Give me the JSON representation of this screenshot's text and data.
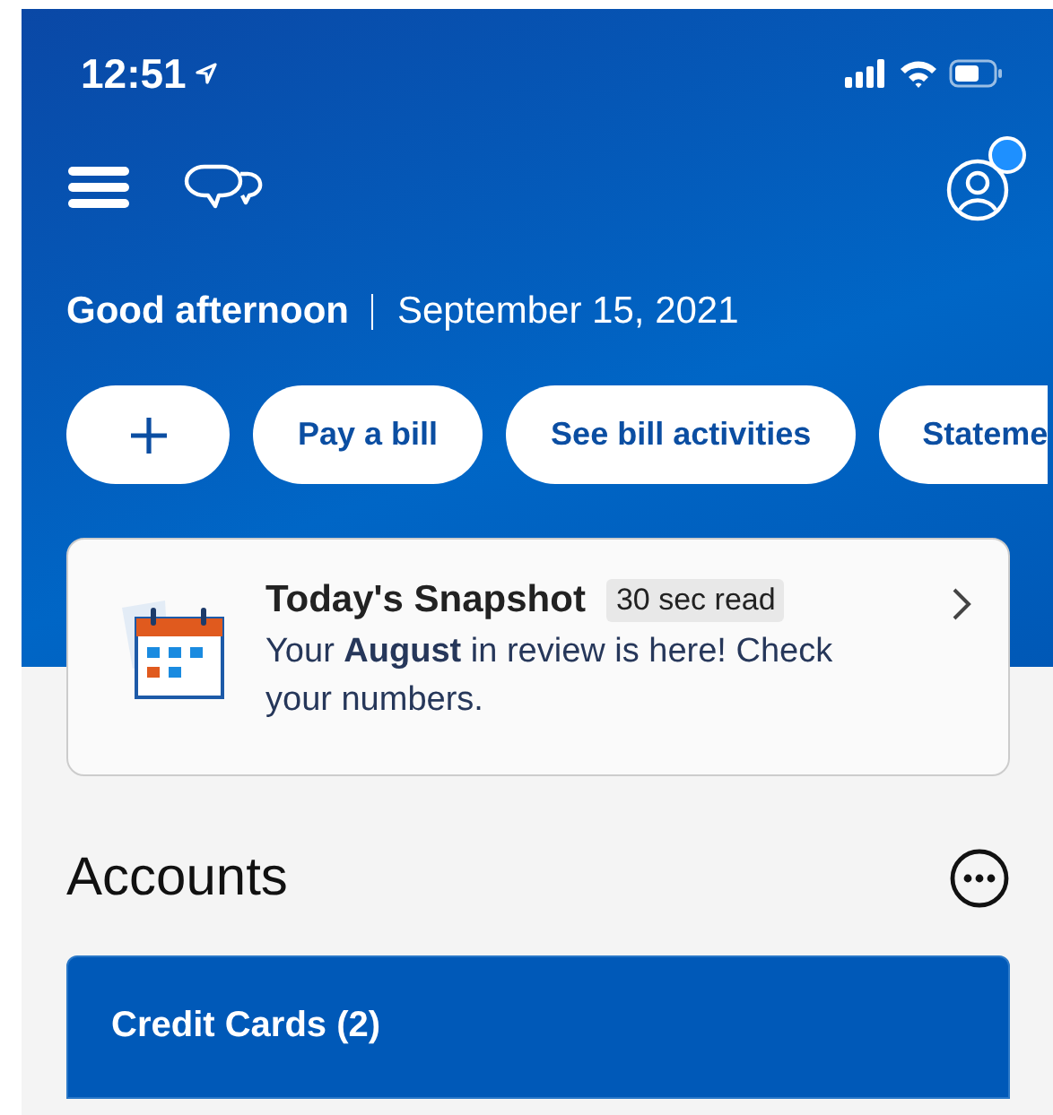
{
  "status_bar": {
    "time": "12:51"
  },
  "nav": {
    "profile_notification": true
  },
  "greeting": {
    "salutation": "Good afternoon",
    "date": "September 15, 2021"
  },
  "quick_actions": [
    {
      "kind": "add"
    },
    {
      "kind": "text",
      "label": "Pay a bill"
    },
    {
      "kind": "text",
      "label": "See bill activities"
    },
    {
      "kind": "text",
      "label": "Stateme"
    }
  ],
  "snapshot": {
    "title": "Today's Snapshot",
    "badge": "30 sec read",
    "message": "Your **August** in review is here! Check your numbers."
  },
  "accounts": {
    "title": "Accounts",
    "groups": [
      {
        "label": "Credit Cards (2)"
      }
    ]
  }
}
